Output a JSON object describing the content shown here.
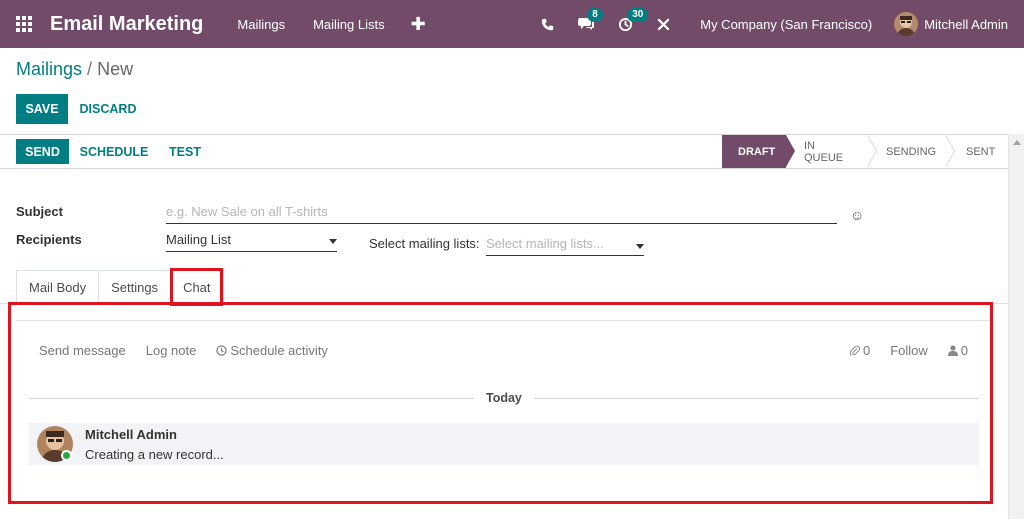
{
  "navbar": {
    "app_title": "Email Marketing",
    "menus": [
      "Mailings",
      "Mailing Lists"
    ],
    "plus_icon": "plus-icon",
    "messages_badge": "8",
    "activities_badge": "30",
    "company": "My Company (San Francisco)",
    "user": "Mitchell Admin",
    "accent_color": "#714b67"
  },
  "breadcrumb": {
    "parent": "Mailings",
    "separator": "/",
    "current": "New"
  },
  "buttons": {
    "save": "SAVE",
    "discard": "DISCARD"
  },
  "statusbar": {
    "send": "SEND",
    "schedule": "SCHEDULE",
    "test": "TEST",
    "stages": [
      "DRAFT",
      "IN QUEUE",
      "SENDING",
      "SENT"
    ],
    "active_stage": "DRAFT"
  },
  "form": {
    "subject_label": "Subject",
    "subject_placeholder": "e.g. New Sale on all T-shirts",
    "recipients_label": "Recipients",
    "recipients_value": "Mailing List",
    "mailing_lists_label": "Select mailing lists:",
    "mailing_lists_placeholder": "Select mailing lists..."
  },
  "tabs": [
    "Mail Body",
    "Settings",
    "Chat"
  ],
  "active_tab": "Chat",
  "chatter": {
    "send_message": "Send message",
    "log_note": "Log note",
    "schedule_activity": "Schedule activity",
    "attachments_count": "0",
    "follow": "Follow",
    "followers_count": "0",
    "date_separator": "Today",
    "messages": [
      {
        "author": "Mitchell Admin",
        "body": "Creating a new record..."
      }
    ]
  },
  "highlight_color": "#e0141e",
  "primary_color": "#017e84"
}
